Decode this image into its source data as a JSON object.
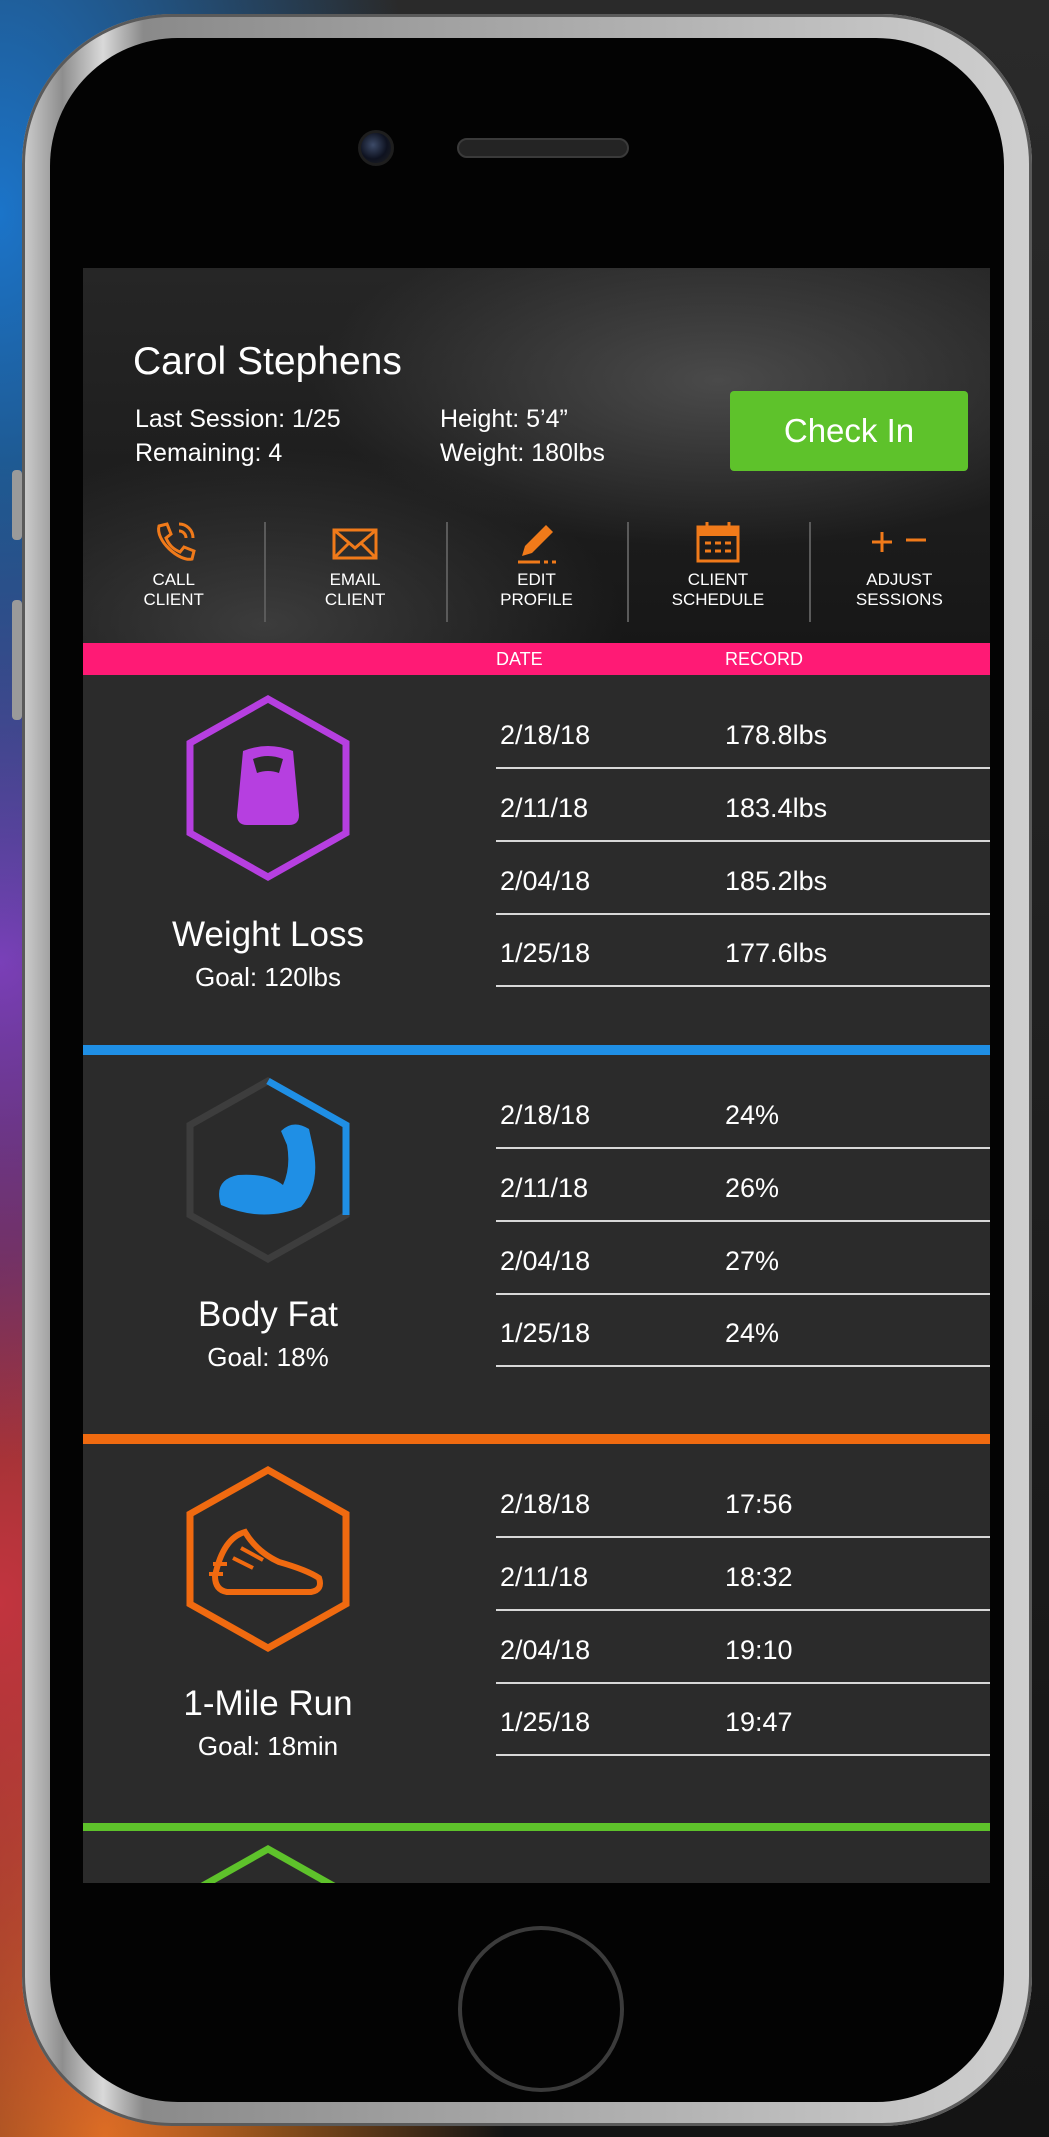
{
  "client": {
    "name": "Carol Stephens",
    "last_session": "Last Session: 1/25",
    "remaining": "Remaining: 4",
    "height": "Height: 5’4”",
    "weight": "Weight: 180lbs",
    "checkin_label": "Check In"
  },
  "actions": [
    {
      "icon": "phone-icon",
      "label": "CALL CLIENT"
    },
    {
      "icon": "envelope-icon",
      "label": "EMAIL CLIENT"
    },
    {
      "icon": "pencil-icon",
      "label": "EDIT PROFILE"
    },
    {
      "icon": "calendar-icon",
      "label": "CLIENT SCHEDULE"
    },
    {
      "icon": "plus-minus-icon",
      "label": "ADJUST SESSIONS"
    }
  ],
  "table_headers": {
    "date": "DATE",
    "record": "RECORD"
  },
  "metrics": [
    {
      "title": "Weight Loss",
      "goal": "Goal: 120lbs",
      "color": "#b63fe0",
      "icon": "scale-icon",
      "rows": [
        {
          "date": "2/18/18",
          "record": "178.8lbs"
        },
        {
          "date": "2/11/18",
          "record": "183.4lbs"
        },
        {
          "date": "2/04/18",
          "record": "185.2lbs"
        },
        {
          "date": "1/25/18",
          "record": "177.6lbs"
        }
      ]
    },
    {
      "title": "Body Fat",
      "goal": "Goal: 18%",
      "color": "#1f8fe5",
      "icon": "flexed-arm-icon",
      "rows": [
        {
          "date": "2/18/18",
          "record": "24%"
        },
        {
          "date": "2/11/18",
          "record": "26%"
        },
        {
          "date": "2/04/18",
          "record": "27%"
        },
        {
          "date": "1/25/18",
          "record": "24%"
        }
      ]
    },
    {
      "title": "1-Mile Run",
      "goal": "Goal: 18min",
      "color": "#f06a10",
      "icon": "running-shoe-icon",
      "rows": [
        {
          "date": "2/18/18",
          "record": "17:56"
        },
        {
          "date": "2/11/18",
          "record": "18:32"
        },
        {
          "date": "2/04/18",
          "record": "19:10"
        },
        {
          "date": "1/25/18",
          "record": "19:47"
        }
      ]
    }
  ],
  "colors": {
    "checkin": "#5ec22b",
    "header_bar": "#ff1a75",
    "action_icons": "#f07a1a",
    "fourth_section": "#5ec22b"
  }
}
